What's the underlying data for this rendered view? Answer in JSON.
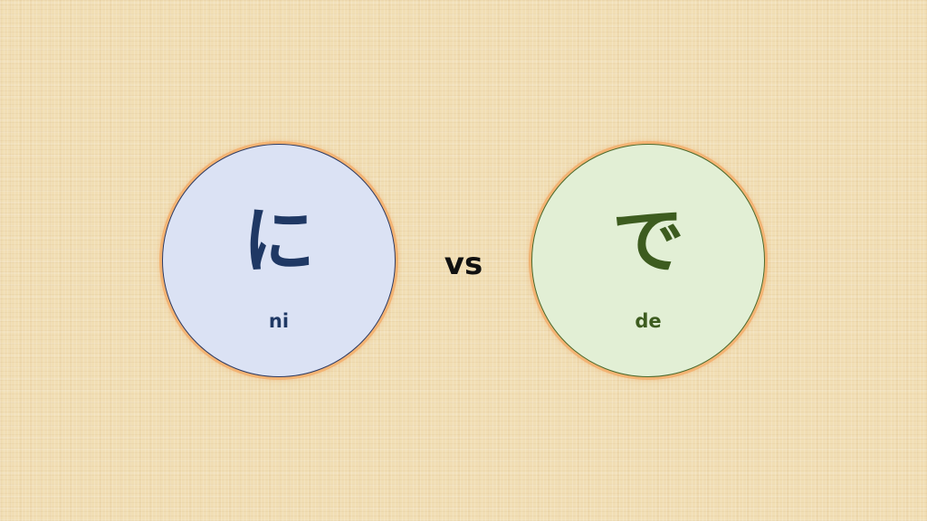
{
  "left": {
    "kana": "に",
    "romaji": "ni",
    "text_color": "#1f3864",
    "fill_color": "#dbe2f4"
  },
  "separator": {
    "label": "vs"
  },
  "right": {
    "kana": "で",
    "romaji": "de",
    "text_color": "#3d5c1f",
    "fill_color": "#e2efd5"
  },
  "background_color": "#f1deb4"
}
